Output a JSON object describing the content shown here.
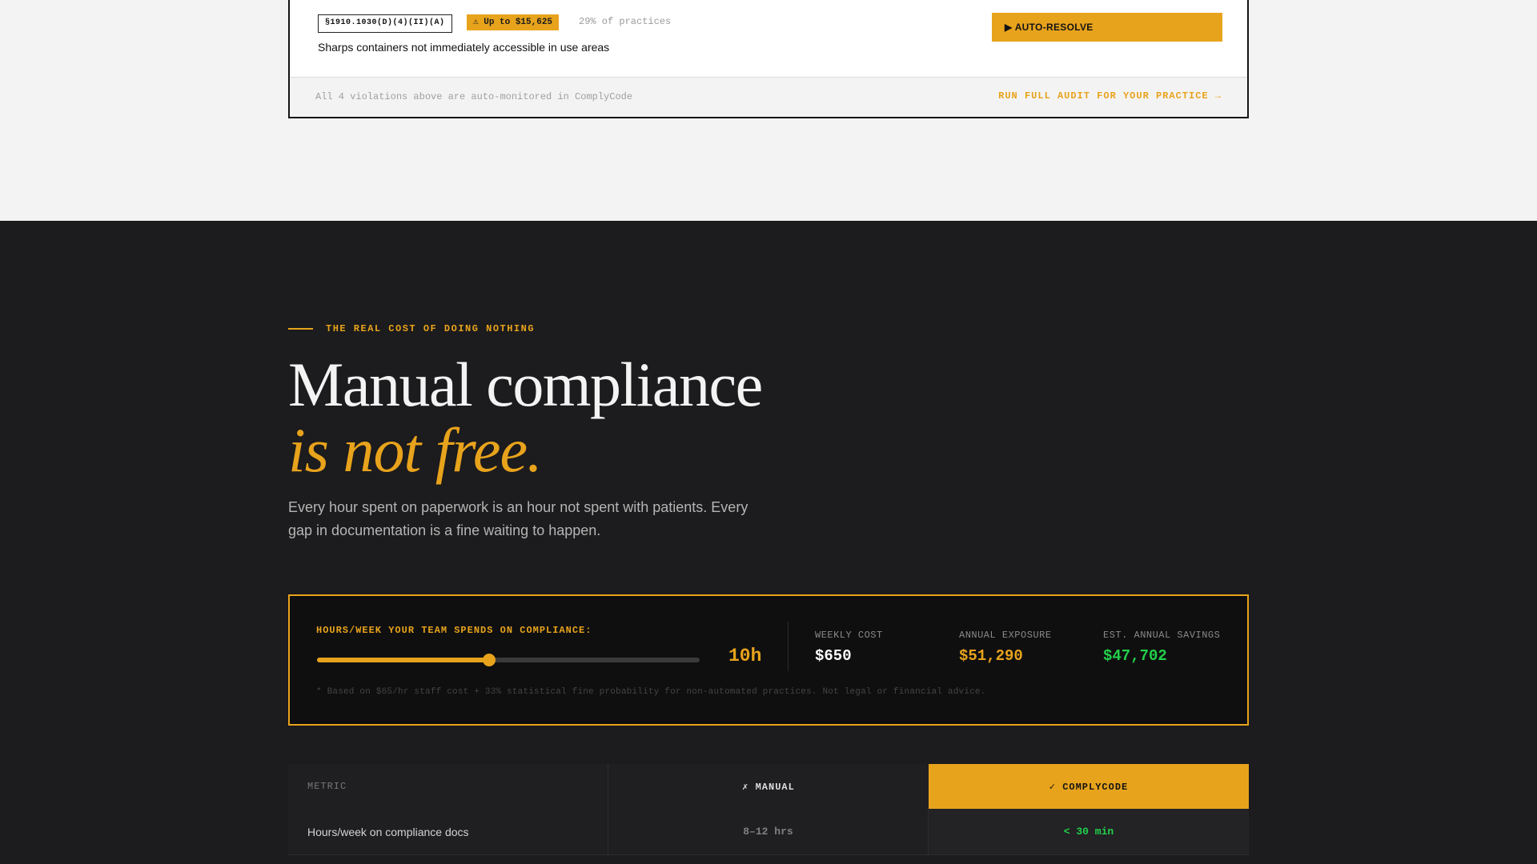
{
  "violation": {
    "code": "§1910.1030(D)(4)(II)(A)",
    "fine_badge": "⚠ Up to $15,625",
    "prevalence": "29% of practices",
    "description": "Sharps containers not immediately accessible in use areas",
    "action_label": "▶ AUTO-RESOLVE"
  },
  "violations_footer": {
    "note": "All 4 violations above are auto-monitored in ComplyCode",
    "link_label": "RUN FULL AUDIT FOR YOUR PRACTICE →"
  },
  "cost_section": {
    "eyebrow": "THE REAL COST OF DOING NOTHING",
    "headline_main": "Manual compliance",
    "headline_accent": "is not free.",
    "subhead": "Every hour spent on paperwork is an hour not spent with patients. Every gap in documentation is a fine waiting to happen."
  },
  "calculator": {
    "label": "HOURS/WEEK YOUR TEAM SPENDS ON COMPLIANCE:",
    "slider_fraction": 0.45,
    "slider_value": "10h",
    "weekly_cost_label": "WEEKLY COST",
    "weekly_cost": "$650",
    "annual_exposure_label": "ANNUAL EXPOSURE",
    "annual_exposure": "$51,290",
    "savings_label": "EST. ANNUAL SAVINGS",
    "savings": "$47,702",
    "footnote": "* Based on $65/hr staff cost + 33% statistical fine probability for non-automated practices. Not legal or financial advice."
  },
  "comparison": {
    "headers": {
      "metric": "METRIC",
      "manual": "✗ MANUAL",
      "complycode": "✓ COMPLYCODE"
    },
    "rows": [
      {
        "metric": "Hours/week on compliance docs",
        "manual": "8–12 hrs",
        "complycode": "< 30 min"
      }
    ]
  },
  "colors": {
    "accent": "#e8a31c",
    "success": "#22d04a",
    "dark_bg": "#1c1b1d",
    "light_bg": "#f4f3f3"
  }
}
